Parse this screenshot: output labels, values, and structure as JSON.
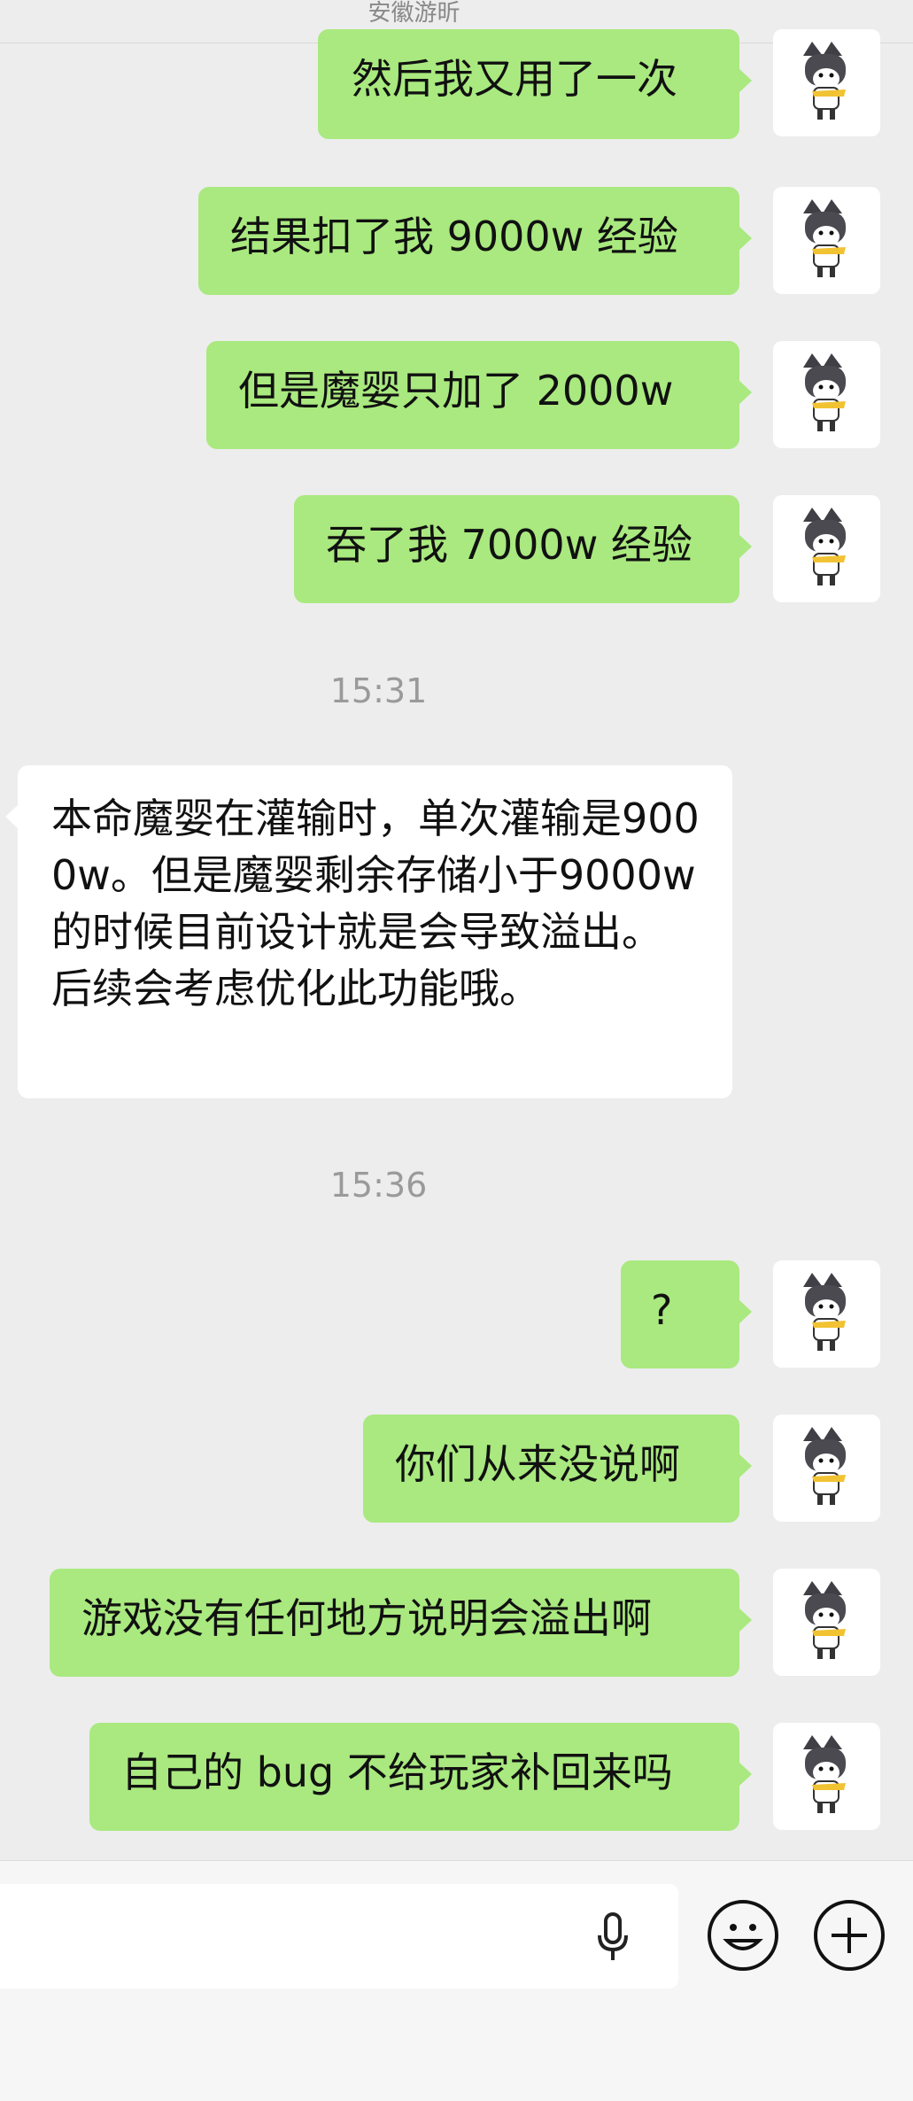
{
  "header": {
    "title": "安徽游昕"
  },
  "messages": [
    {
      "side": "out",
      "text": "然后我又用了一次"
    },
    {
      "side": "out",
      "text": "结果扣了我 9000w 经验"
    },
    {
      "side": "out",
      "text": "但是魔婴只加了 2000w"
    },
    {
      "side": "out",
      "text": "吞了我 7000w 经验"
    },
    {
      "timestamp": "15:31"
    },
    {
      "side": "in",
      "text": "本命魔婴在灌输时，单次灌输是9000w。但是魔婴剩余存储小于9000w的时候目前设计就是会导致溢出。后续会考虑优化此功能哦。"
    },
    {
      "timestamp": "15:36"
    },
    {
      "side": "out",
      "text": "?"
    },
    {
      "side": "out",
      "text": "你们从来没说啊"
    },
    {
      "side": "out",
      "text": "游戏没有任何地方说明会溢出啊"
    },
    {
      "side": "out",
      "text": "自己的 bug 不给玩家补回来吗"
    }
  ],
  "input_bar": {
    "placeholder": "",
    "icons": [
      "microphone-icon",
      "emoji-icon",
      "plus-icon"
    ]
  },
  "colors": {
    "background": "#ededed",
    "outgoing_bubble": "#a9e97f",
    "incoming_bubble": "#ffffff",
    "timestamp_text": "#9a9a9a"
  }
}
